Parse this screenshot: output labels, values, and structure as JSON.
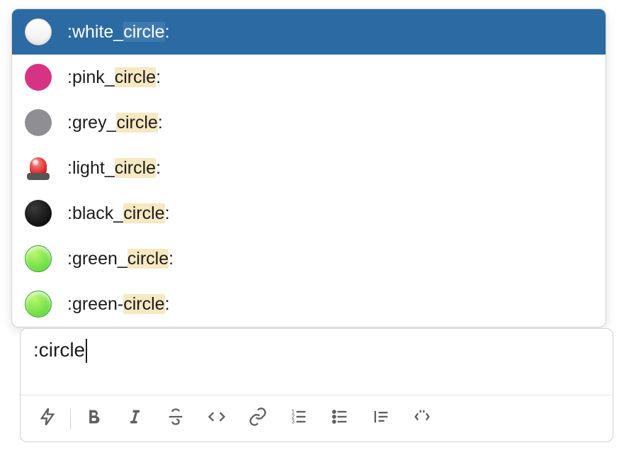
{
  "composer": {
    "input_text": ":circle"
  },
  "emoji_picker": {
    "highlight": "circle",
    "items": [
      {
        "name": ":white_circle:",
        "prefix": ":white_",
        "selected": true,
        "icon": "white-circle"
      },
      {
        "name": ":pink_circle:",
        "prefix": ":pink_",
        "selected": false,
        "icon": "pink-circle"
      },
      {
        "name": ":grey_circle:",
        "prefix": ":grey_",
        "selected": false,
        "icon": "grey-circle"
      },
      {
        "name": ":light_circle:",
        "prefix": ":light_",
        "selected": false,
        "icon": "siren"
      },
      {
        "name": ":black_circle:",
        "prefix": ":black_",
        "selected": false,
        "icon": "black-circle"
      },
      {
        "name": ":green_circle:",
        "prefix": ":green_",
        "selected": false,
        "icon": "green-circle"
      },
      {
        "name": ":green-circle:",
        "prefix": ":green-",
        "selected": false,
        "icon": "green-circle"
      }
    ],
    "suffix": ":"
  },
  "toolbar": {
    "shortcuts_button": "Shortcuts",
    "bold_button": "Bold",
    "italic_button": "Italic",
    "strike_button": "Strikethrough",
    "code_button": "Code",
    "link_button": "Link",
    "ordered_list_button": "Ordered list",
    "bulleted_list_button": "Bulleted list",
    "blockquote_button": "Blockquote",
    "code_block_button": "Code block"
  }
}
